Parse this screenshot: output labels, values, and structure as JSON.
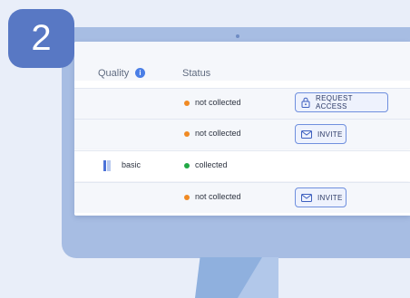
{
  "step_badge": "2",
  "table": {
    "headers": {
      "quality": "Quality",
      "status": "Status"
    },
    "rows": [
      {
        "quality": "",
        "status": "not collected",
        "status_color": "#f08a24",
        "action": "REQUEST ACCESS",
        "action_icon": "lock-icon"
      },
      {
        "quality": "",
        "status": "not collected",
        "status_color": "#f08a24",
        "action": "INVITE",
        "action_icon": "mail-icon"
      },
      {
        "quality": "basic",
        "status": "collected",
        "status_color": "#22a845",
        "action": "",
        "action_icon": ""
      },
      {
        "quality": "",
        "status": "not collected",
        "status_color": "#f08a24",
        "action": "INVITE",
        "action_icon": "mail-icon"
      }
    ]
  },
  "colors": {
    "accent": "#4a7ee6",
    "monitor": "#a7bde3",
    "badge": "#5878c4"
  }
}
